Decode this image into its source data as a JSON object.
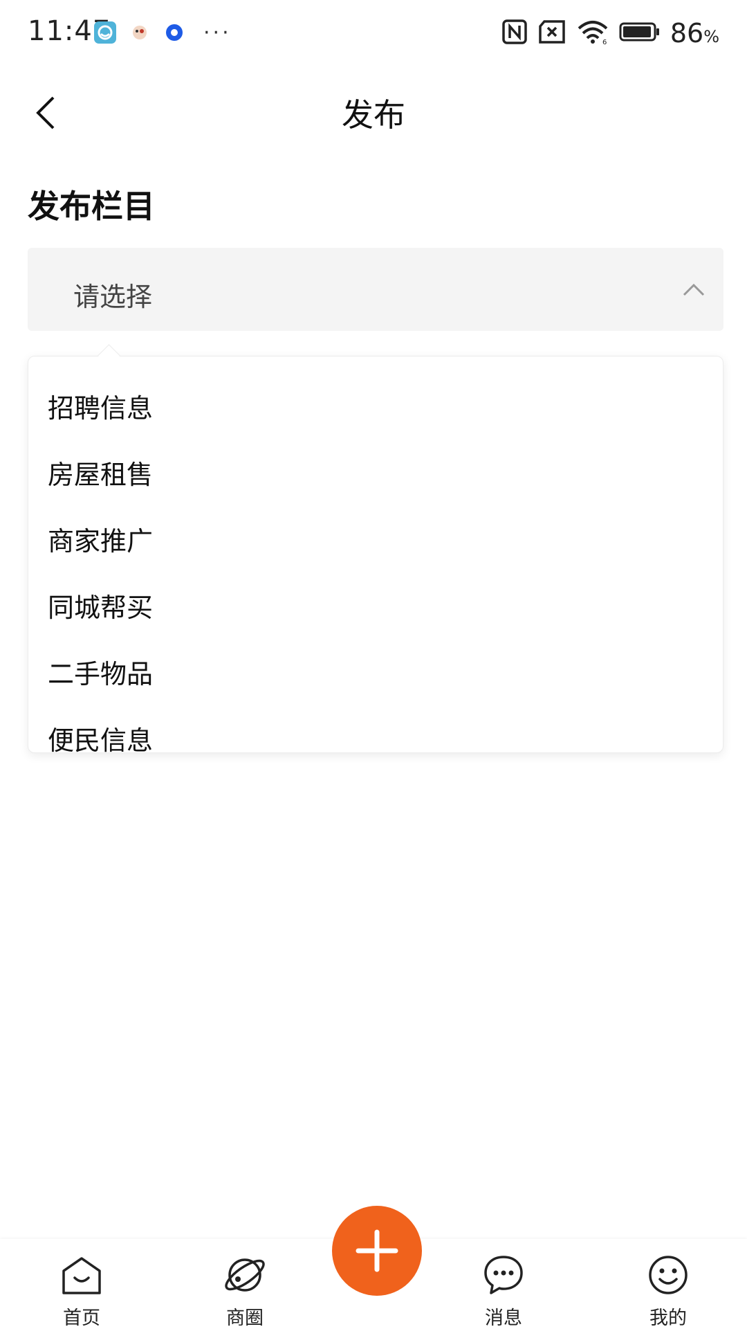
{
  "status_bar": {
    "time": "11:47",
    "dots": "···",
    "battery_percent": "86",
    "battery_unit": "%",
    "icons": [
      "app-icon-blue",
      "app-icon-bird",
      "app-icon-blue-circle",
      "nfc-icon",
      "sim-x-icon",
      "wifi-icon",
      "battery-icon"
    ]
  },
  "header": {
    "title": "发布",
    "back_icon": "chevron-left-icon"
  },
  "form": {
    "section_title": "发布栏目",
    "select_placeholder": "请选择",
    "select_icon": "chevron-up-icon"
  },
  "dropdown": {
    "items": [
      "招聘信息",
      "房屋租售",
      "商家推广",
      "同城帮买",
      "二手物品",
      "便民信息"
    ]
  },
  "tabbar": {
    "tabs": [
      {
        "label": "首页",
        "icon": "home-icon"
      },
      {
        "label": "商圈",
        "icon": "planet-icon"
      },
      {
        "label": "消息",
        "icon": "chat-bubble-icon"
      },
      {
        "label": "我的",
        "icon": "smiley-icon"
      }
    ],
    "fab_icon": "plus-icon"
  },
  "colors": {
    "accent": "#f0621c",
    "select_bg": "#f4f4f4"
  }
}
